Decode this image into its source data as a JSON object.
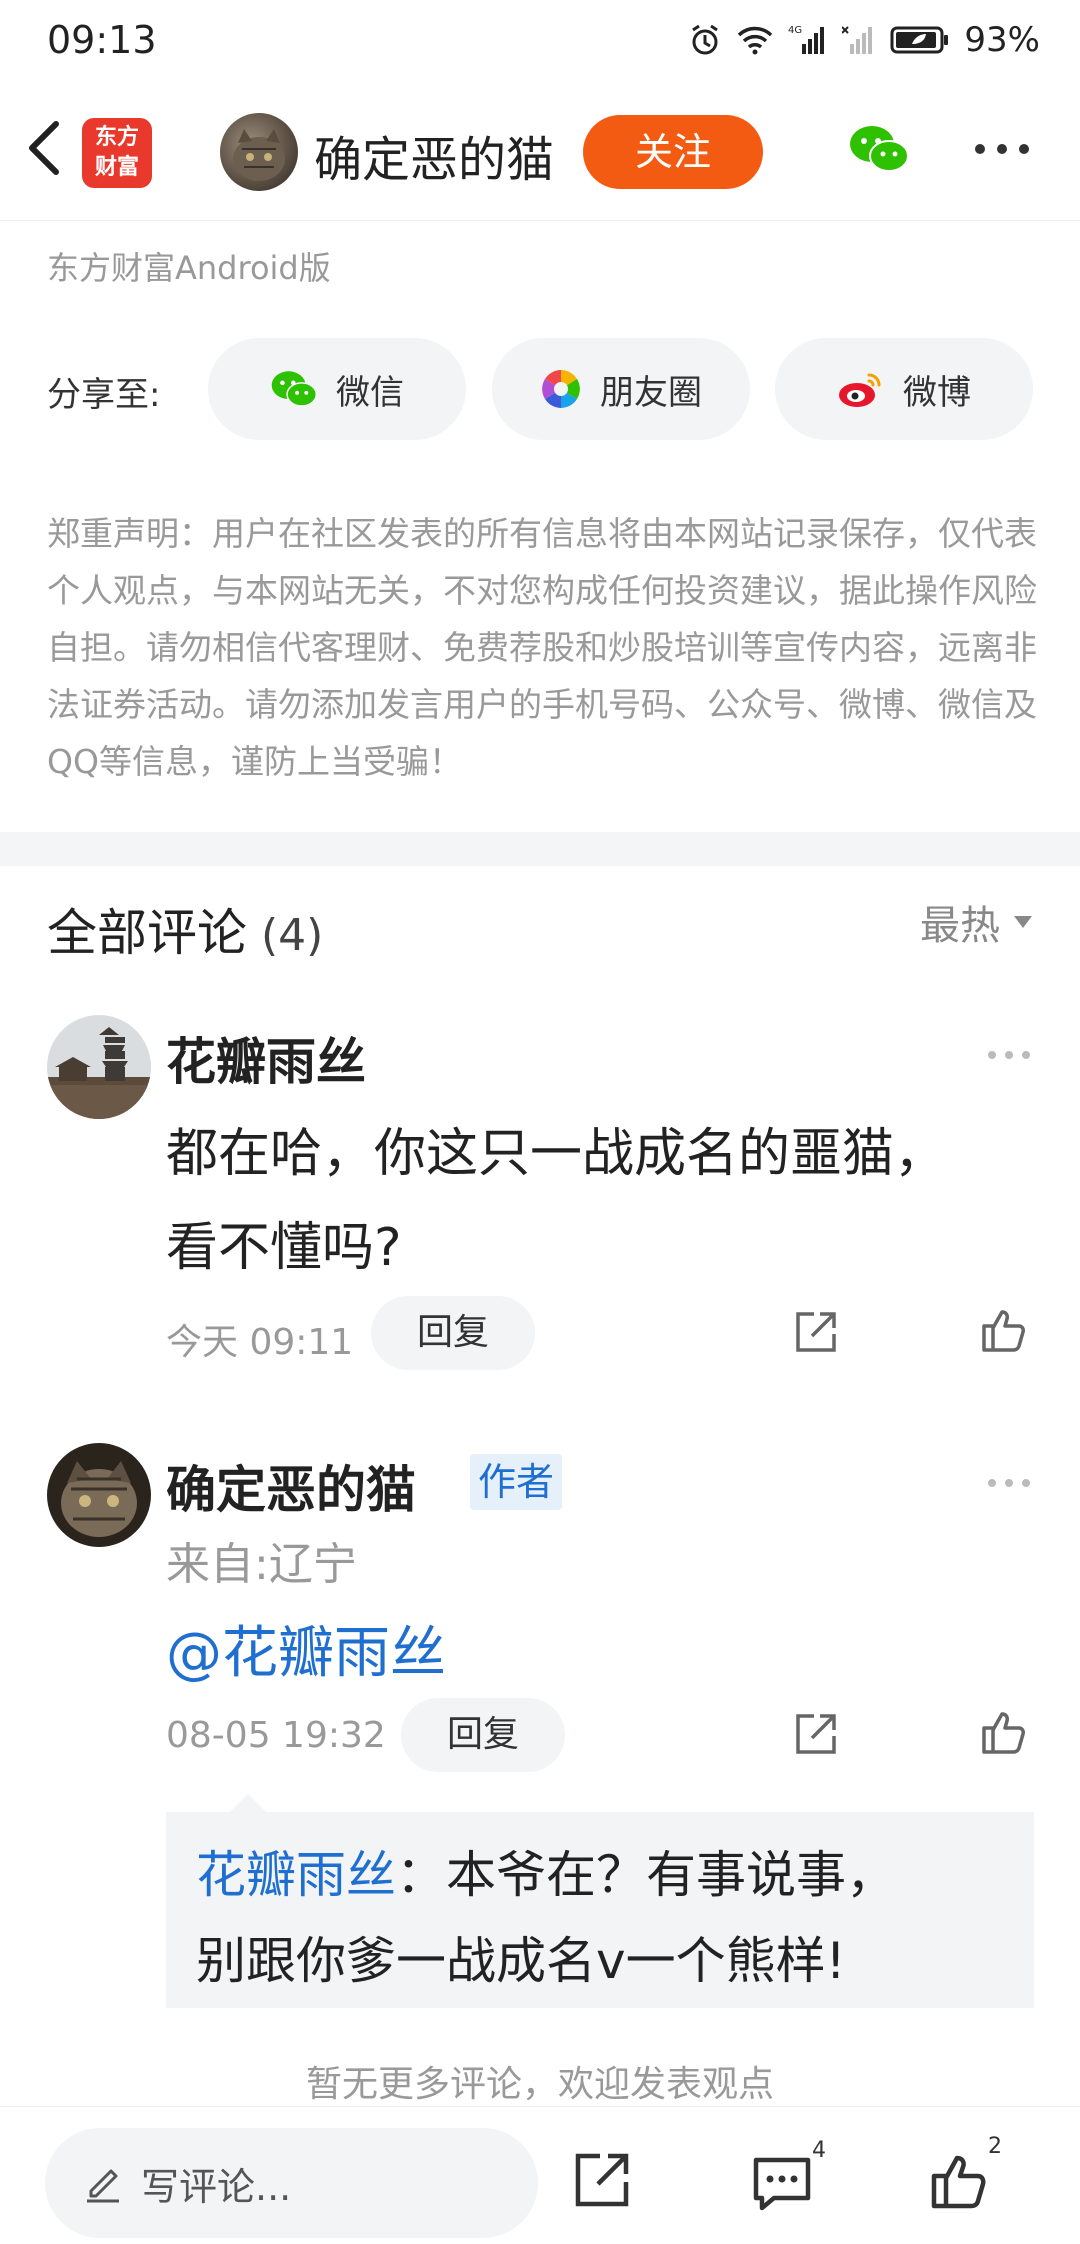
{
  "status_bar": {
    "time": "09:13",
    "battery": "93%",
    "network": "4G"
  },
  "header": {
    "logo_line1": "东方",
    "logo_line2": "财富",
    "author_name": "确定恶的猫",
    "follow_label": "关注",
    "icons": [
      "back-icon",
      "wechat-icon",
      "more-icon"
    ]
  },
  "source_text": "东方财富Android版",
  "share": {
    "label": "分享至:",
    "wechat": "微信",
    "moments": "朋友圈",
    "weibo": "微博"
  },
  "disclaimer": "郑重声明：用户在社区发表的所有信息将由本网站记录保存，仅代表个人观点，与本网站无关，不对您构成任何投资建议，据此操作风险自担。请勿相信代客理财、免费荐股和炒股培训等宣传内容，远离非法证券活动。请勿添加发言用户的手机号码、公众号、微博、微信及QQ等信息，谨防上当受骗！",
  "comments": {
    "title": "全部评论",
    "count": "(4)",
    "sort_label": "最热",
    "items": [
      {
        "user": "花瓣雨丝",
        "text_line1": "都在哈，你这只一战成名的噩猫，",
        "text_line2": "看不懂吗?",
        "time": "今天 09:11",
        "reply_label": "回复"
      },
      {
        "user": "确定恶的猫",
        "badge": "作者",
        "region": "来自:辽宁",
        "mention": "@花瓣雨丝",
        "time": "08-05 19:32",
        "reply_label": "回复",
        "quote_user": "花瓣雨丝",
        "quote_line1": "：本爷在？有事说事，",
        "quote_line2": "别跟你爹一战成名v一个熊样!"
      }
    ],
    "no_more": "暂无更多评论，欢迎发表观点"
  },
  "bottom_bar": {
    "write_placeholder": "写评论...",
    "comment_count": "4",
    "like_count": "2"
  },
  "colors": {
    "accent_orange": "#f45b12",
    "link_blue": "#1f6fd0",
    "brand_red": "#e8392c"
  }
}
